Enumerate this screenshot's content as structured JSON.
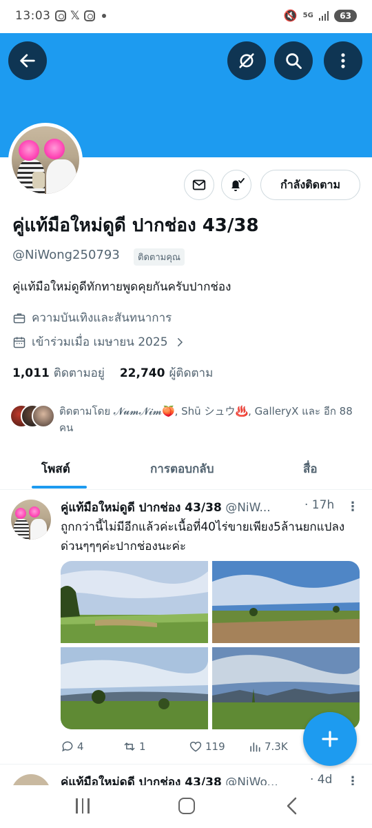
{
  "status_bar": {
    "time": "13:03",
    "network": "5G",
    "battery": "63"
  },
  "profile": {
    "display_name": "คู่แท้มือใหม่ดูดี ปากช่อง 43/38",
    "handle": "@NiWong250793",
    "follows_you_badge": "ติดตามคุณ",
    "bio": "คู่แท้มือใหม่ดูดีทักทายพูดคุยกันครับปากช่อง",
    "category": "ความบันเทิงและสันทนาการ",
    "joined": "เข้าร่วมเมื่อ เมษายน 2025",
    "following_button": "กำลังติดตาม",
    "following_count": "1,011",
    "following_label": "ติดตามอยู่",
    "followers_count": "22,740",
    "followers_label": "ผู้ติดตาม",
    "followed_by_text": "ติดตามโดย 𝓝𝓾𝓶𝓝𝓲𝓶🍑, Shū シュウ♨️, GalleryX และ อีก 88 คน"
  },
  "tabs": [
    {
      "label": "โพสต์",
      "active": true
    },
    {
      "label": "การตอบกลับ",
      "active": false
    },
    {
      "label": "สื่อ",
      "active": false
    }
  ],
  "tweet": {
    "name": "คู่แท้มือใหม่ดูดี ปากช่อง 43/38",
    "handle": "@NiW...",
    "time": "· 17h",
    "text": "ถูกกว่านี้ไม่มีอีกแล้วค่ะเนื้อที่40ไร่ขายเพียง5ล้านยกแปลงด่วนๆๆๆค่ะปากช่องนะค่ะ",
    "replies": "4",
    "reposts": "1",
    "likes": "119",
    "views": "7.3K"
  },
  "next_tweet": {
    "name": "คู่แท้มือใหม่ดูดี ปากช่อง 43/38",
    "handle": "@NiWo...",
    "time": "· 4d"
  },
  "colors": {
    "accent": "#1d9bf0",
    "text_primary": "#0f1419",
    "text_secondary": "#536471"
  }
}
